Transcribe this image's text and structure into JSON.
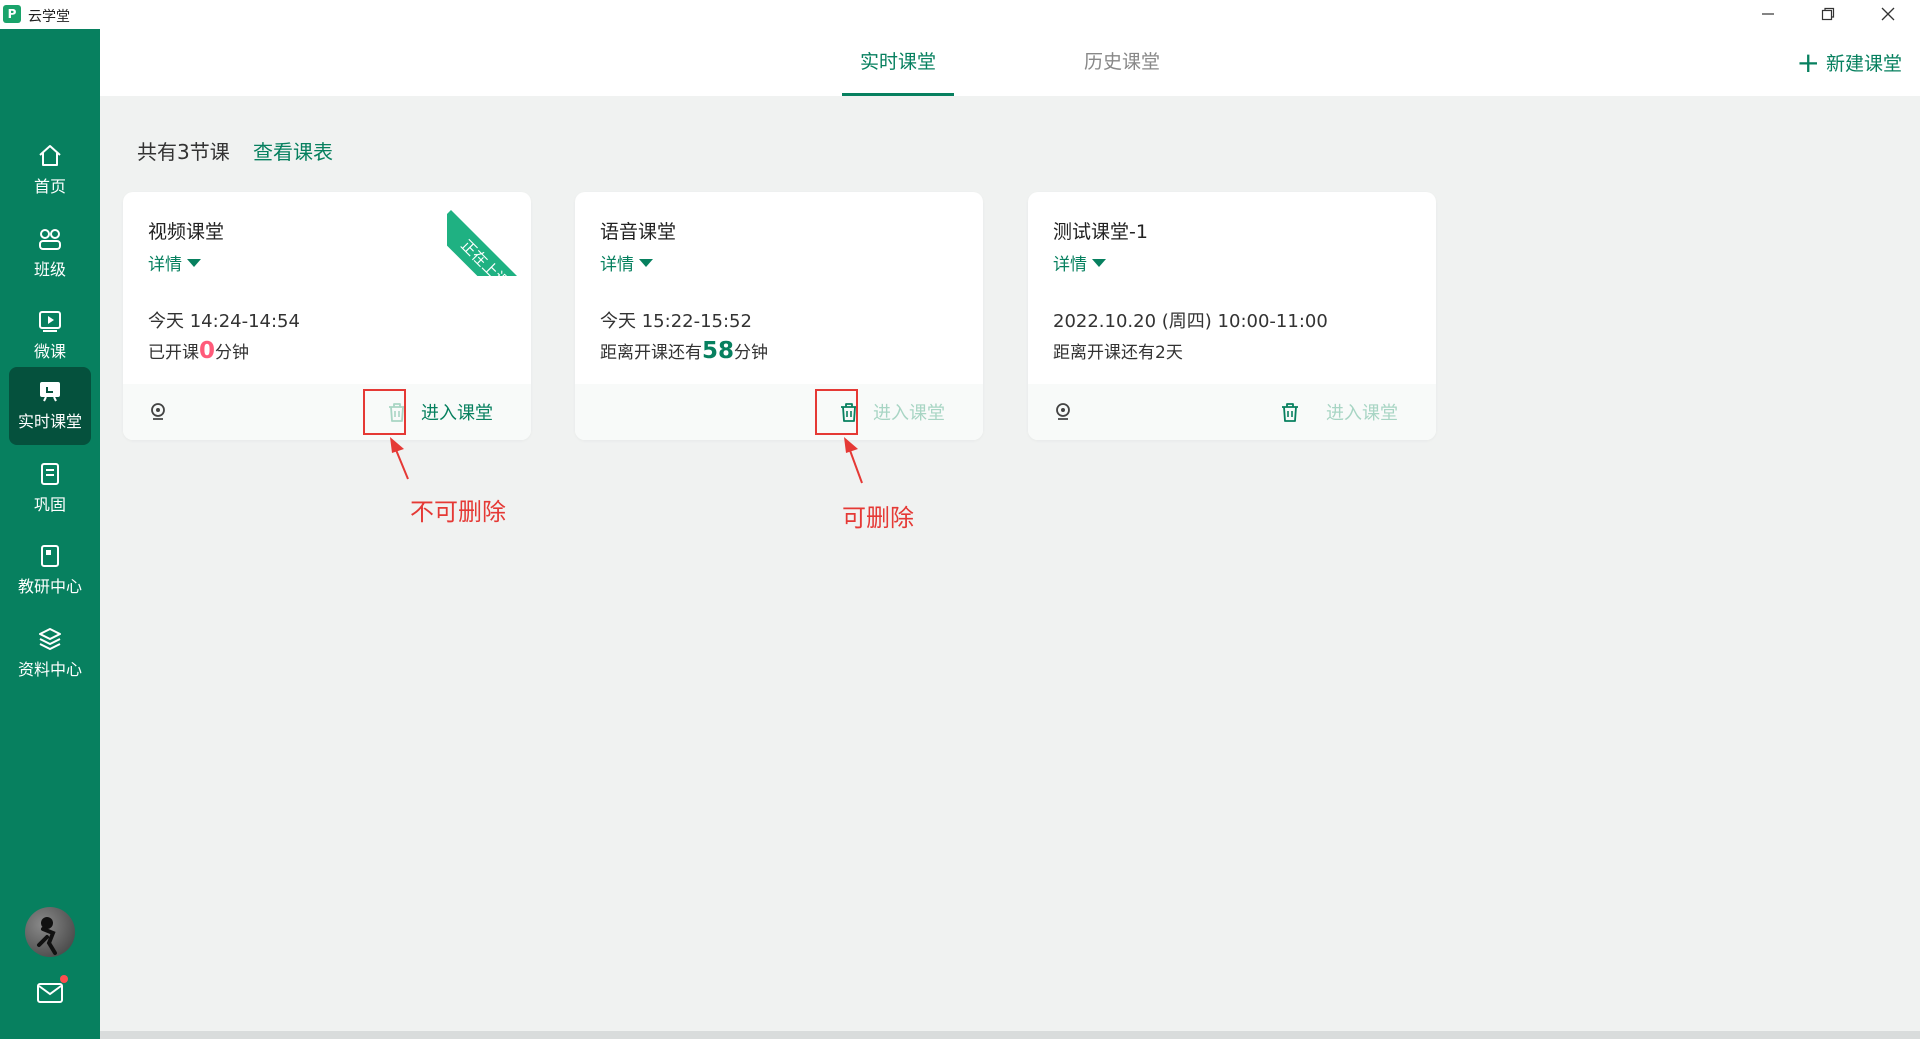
{
  "app": {
    "logo": "P",
    "title": "云学堂"
  },
  "window_controls": {
    "minimize_icon": "minimize-icon",
    "restore_icon": "restore-icon",
    "close_icon": "close-icon"
  },
  "sidebar": {
    "items": [
      {
        "label": "首页",
        "icon": "home-icon",
        "active": false
      },
      {
        "label": "班级",
        "icon": "class-icon",
        "active": false
      },
      {
        "label": "微课",
        "icon": "microlesson-icon",
        "active": false
      },
      {
        "label": "实时课堂",
        "icon": "live-class-icon",
        "active": true
      },
      {
        "label": "巩固",
        "icon": "review-icon",
        "active": false
      },
      {
        "label": "教研中心",
        "icon": "research-icon",
        "active": false
      },
      {
        "label": "资料中心",
        "icon": "layers-icon",
        "active": false
      }
    ],
    "avatar": "avatar",
    "mail_icon": "mail-icon"
  },
  "tabs": {
    "live": "实时课堂",
    "history": "历史课堂",
    "new_button": "新建课堂"
  },
  "summary": {
    "count_text": "共有3节课",
    "schedule_link": "查看课表"
  },
  "cards": [
    {
      "title": "视频课堂",
      "detail": "详情",
      "time": "今天 14:24-14:54",
      "status_prefix": "已开课",
      "status_num": "0",
      "status_suffix": "分钟",
      "ribbon": "正在上课",
      "enter_label": "进入课堂",
      "enter_enabled": true
    },
    {
      "title": "语音课堂",
      "detail": "详情",
      "time": "今天 15:22-15:52",
      "status_prefix": "距离开课还有",
      "status_num": "58",
      "status_suffix": "分钟",
      "enter_label": "进入课堂",
      "enter_enabled": false
    },
    {
      "title": "测试课堂-1",
      "detail": "详情",
      "time": "2022.10.20 (周四) 10:00-11:00",
      "status": "距离开课还有2天",
      "enter_label": "进入课堂",
      "enter_enabled": false
    }
  ],
  "annotations": {
    "not_deletable": "不可删除",
    "deletable": "可删除"
  },
  "colors": {
    "brand": "#07805f",
    "sidebar_active": "#05513d",
    "ribbon": "#1fb182",
    "annotation": "#e53935",
    "countdown_red": "#ff5b7a"
  }
}
